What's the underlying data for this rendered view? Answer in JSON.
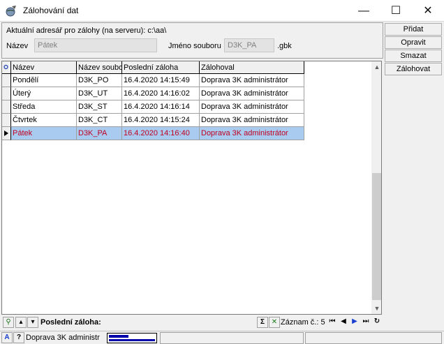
{
  "window": {
    "title": "Zálohování dat"
  },
  "info": {
    "path_label": "Aktuální adresář pro zálohy (na serveru): c:\\aa\\",
    "name_label": "Název",
    "name_value": "Pátek",
    "file_label": "Jméno souboru",
    "file_value": "D3K_PA",
    "file_ext": ".gbk"
  },
  "buttons": {
    "add": "Přidat",
    "edit": "Opravit",
    "delete": "Smazat",
    "backup": "Zálohovat"
  },
  "grid": {
    "headers": [
      "Název",
      "Název soubo",
      "Poslední záloha",
      "Zálohoval"
    ],
    "rows": [
      [
        "Pondělí",
        "D3K_PO",
        "16.4.2020 14:15:49",
        "Doprava 3K administrátor"
      ],
      [
        "Úterý",
        "D3K_UT",
        "16.4.2020 14:16:02",
        "Doprava 3K administrátor"
      ],
      [
        "Středa",
        "D3K_ST",
        "16.4.2020 14:16:14",
        "Doprava 3K administrátor"
      ],
      [
        "Čtvrtek",
        "D3K_CT",
        "16.4.2020 14:15:24",
        "Doprava 3K administrátor"
      ],
      [
        "Pátek",
        "D3K_PA",
        "16.4.2020 14:16:40",
        "Doprava 3K administrátor"
      ]
    ],
    "selected_row": 4
  },
  "toolbar": {
    "last_backup_label": "Poslední záloha:",
    "record_label": "Záznam č.: 5"
  },
  "status": {
    "user": "Doprava 3K administr",
    "lang_badge": "A",
    "help_badge": "?"
  },
  "colors": {
    "selection": "#a9cbef",
    "selected_text": "#c00020",
    "accent": "#0000aa"
  }
}
